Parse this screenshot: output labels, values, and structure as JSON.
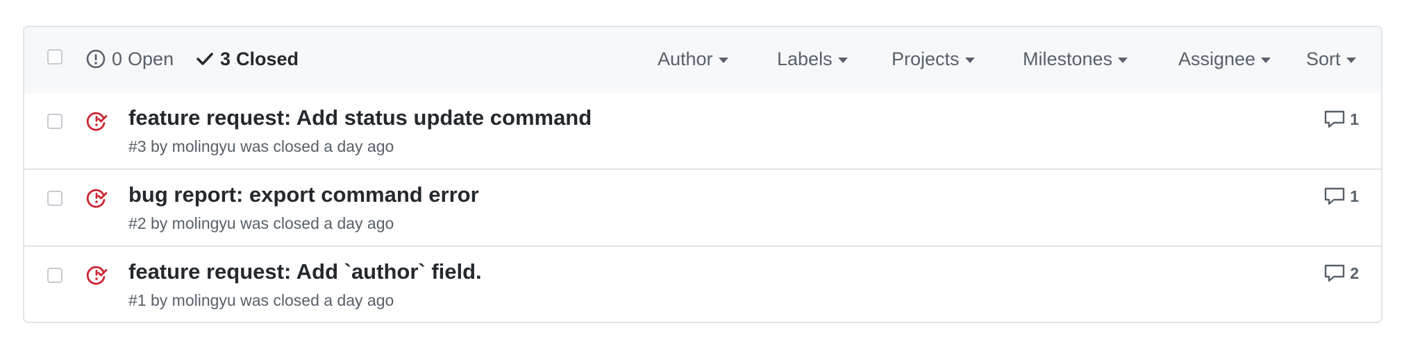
{
  "header": {
    "open": {
      "count": "0",
      "label": "Open"
    },
    "closed": {
      "count": "3",
      "label": "Closed"
    },
    "filters": [
      "Author",
      "Labels",
      "Projects",
      "Milestones",
      "Assignee",
      "Sort"
    ]
  },
  "issues": [
    {
      "title": "feature request: Add status update command",
      "meta": "#3 by molingyu was closed a day ago",
      "comments": "1"
    },
    {
      "title": "bug report: export command error",
      "meta": "#2 by molingyu was closed a day ago",
      "comments": "1"
    },
    {
      "title": "feature request: Add `author` field.",
      "meta": "#1 by molingyu was closed a day ago",
      "comments": "2"
    }
  ],
  "colors": {
    "closed_icon": "#cb2431",
    "header_bg": "#f6f8fa",
    "border": "#e1e4e8"
  }
}
